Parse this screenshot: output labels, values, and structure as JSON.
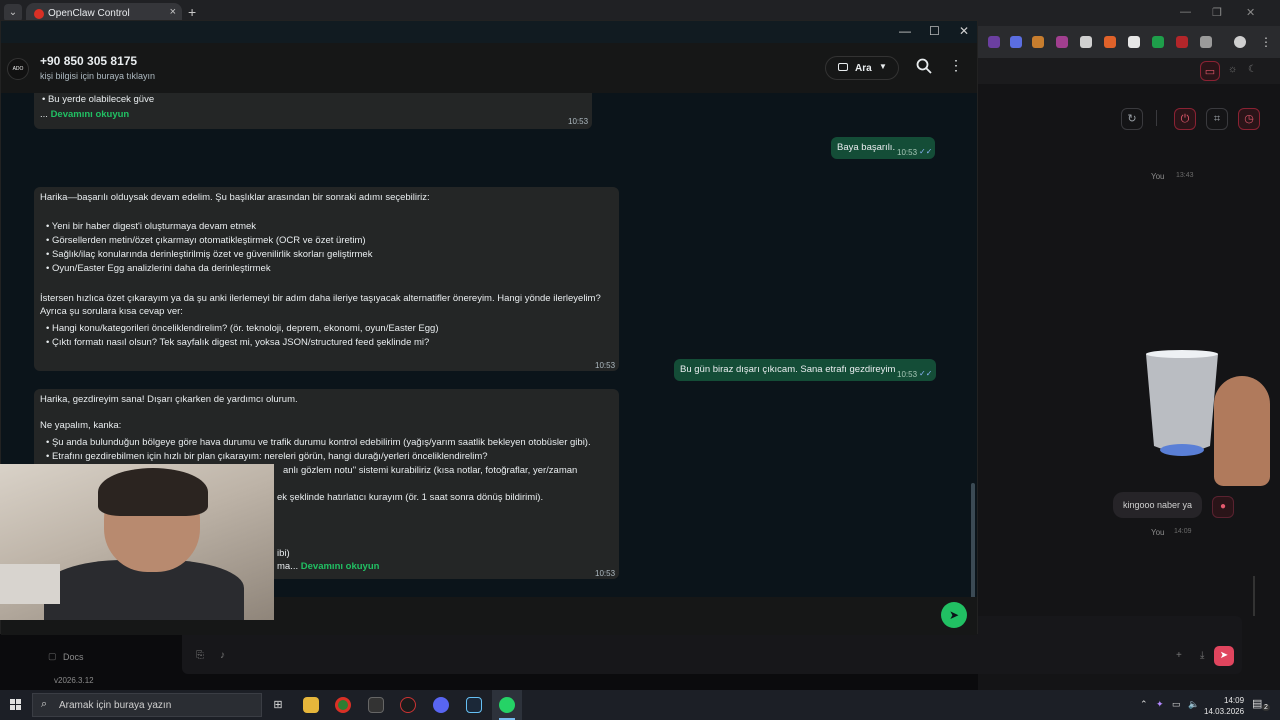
{
  "browser": {
    "tab_title": "OpenClaw Control",
    "new_tab": "+",
    "close": "×"
  },
  "whatsapp": {
    "window_controls": {
      "minimize": "—",
      "maximize": "☐",
      "close": "✕"
    },
    "contact": {
      "name": "+90 850 305 8175",
      "subtitle": "kişi bilgisi için buraya tıklayın",
      "avatar_text": "ADO"
    },
    "call_label": "Ara",
    "messages": {
      "m1": {
        "bullet": "Bu yerde olabilecek güve",
        "more": "Devamını okuyun",
        "more_prefix": "...",
        "time": "10:53"
      },
      "m2": {
        "text": "Baya başarılı.",
        "time": "10:53"
      },
      "m3": {
        "intro": "Harika—başarılı olduysak devam edelim. Şu başlıklar arasından bir sonraki adımı seçebiliriz:",
        "bullets": [
          "Yeni bir haber digest'i oluşturmaya devam etmek",
          "Görsellerden metin/özet çıkarmayı otomatikleştirmek (OCR ve özet üretim)",
          "Sağlık/ilaç konularında derinleştirilmiş özet ve güvenilirlik skorları geliştirmek",
          "Oyun/Easter Egg analizlerini daha da derinleştirmek"
        ],
        "para1": "İstersen hızlıca özet çıkarayım ya da şu anki ilerlemeyi bir adım daha ileriye taşıyacak alternatifler önereyim. Hangi yönde ilerleyelim?",
        "para2": "Ayrıca şu sorulara kısa cevap ver:",
        "questions": [
          "Hangi konu/kategorileri önceliklendirelim? (ör. teknoloji, deprem, ekonomi, oyun/Easter Egg)",
          "Çıktı formatı nasıl olsun? Tek sayfalık digest mi, yoksa JSON/structured feed şeklinde mi?"
        ],
        "time": "10:53"
      },
      "m4": {
        "text": "Bu gün biraz dışarı çıkıcam. Sana etrafı gezdireyim",
        "time": "10:53"
      },
      "m5": {
        "intro": "Harika, gezdireyim sana! Dışarı çıkarken de yardımcı olurum.",
        "heading": "Ne yapalım, kanka:",
        "bullets": [
          "Şu anda bulunduğun bölgeye göre hava durumu ve trafik durumu kontrol edebilirim (yağış/yarım saatlik bekleyen otobüsler gibi).",
          "Etrafını gezdirebilmen için hızlı bir plan çıkarayım: nereleri görün, hangi durağı/yerleri önceliklendirelim?"
        ],
        "partial1": "anlı gözlem notu\" sistemi kurabiliriz (kısa notlar, fotoğraflar, yer/zaman",
        "partial2": "ek şeklinde hatırlatıcı kurayım (ör. 1 saat sonra dönüş bildirimi).",
        "partial3": "ibi)",
        "partial4": "ma...",
        "more": "Devamını okuyun",
        "time": "10:53"
      }
    }
  },
  "right_panel": {
    "you_label_1": "You",
    "time_1": "13:43",
    "bubble_text": "kingooo naber ya",
    "you_label_2": "You",
    "time_2": "14:09",
    "docs_label": "Docs",
    "version": "v2026.3.12"
  },
  "taskbar": {
    "search_placeholder": "Aramak için buraya yazın",
    "time": "14:09",
    "date": "14.03.2026",
    "notification_count": "2"
  },
  "colors": {
    "wa_green": "#21c063",
    "wa_out_bubble": "#144d37",
    "wa_in_bubble": "#242626",
    "wa_bg": "#0b141a"
  }
}
